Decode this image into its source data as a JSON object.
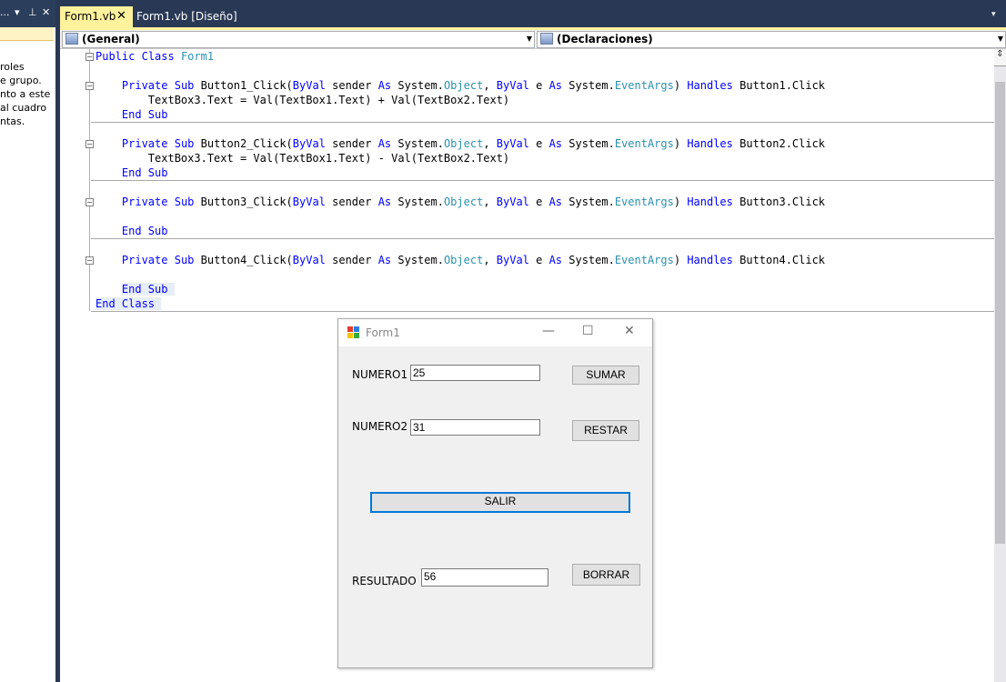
{
  "toolbox": {
    "header_text": "...",
    "description_lines": [
      "roles",
      "e grupo.",
      "nto a este",
      "al cuadro",
      "ntas."
    ]
  },
  "tabs": [
    {
      "label": "Form1.vb",
      "active": true
    },
    {
      "label": "Form1.vb [Diseño]",
      "active": false
    }
  ],
  "nav": {
    "left_combo": "(General)",
    "right_combo": "(Declaraciones)"
  },
  "code": {
    "class_decl": [
      "Public",
      "Class",
      "Form1"
    ],
    "methods": [
      {
        "name": "Button1_Click",
        "handles": "Button1.Click",
        "body": "TextBox3.Text = Val(TextBox1.Text) + Val(TextBox2.Text)"
      },
      {
        "name": "Button2_Click",
        "handles": "Button2.Click",
        "body": "TextBox3.Text = Val(TextBox1.Text) - Val(TextBox2.Text)"
      },
      {
        "name": "Button3_Click",
        "handles": "Button3.Click",
        "body": ""
      },
      {
        "name": "Button4_Click",
        "handles": "Button4.Click",
        "body": ""
      }
    ],
    "end_sub": "End Sub",
    "end_class": "End Class"
  },
  "form": {
    "title": "Form1",
    "numero1_label": "NUMERO1",
    "numero1_value": "25",
    "numero2_label": "NUMERO2",
    "numero2_value": "31",
    "resultado_label": "RESULTADO",
    "resultado_value": "56",
    "sumar_label": "SUMAR",
    "restar_label": "RESTAR",
    "salir_label": "SALIR",
    "borrar_label": "BORRAR"
  },
  "colors": {
    "keyword": "#0000ff",
    "type": "#2b91af",
    "active_tab": "#fff29d",
    "ide_frame": "#293955",
    "focus_border": "#0078d7"
  }
}
